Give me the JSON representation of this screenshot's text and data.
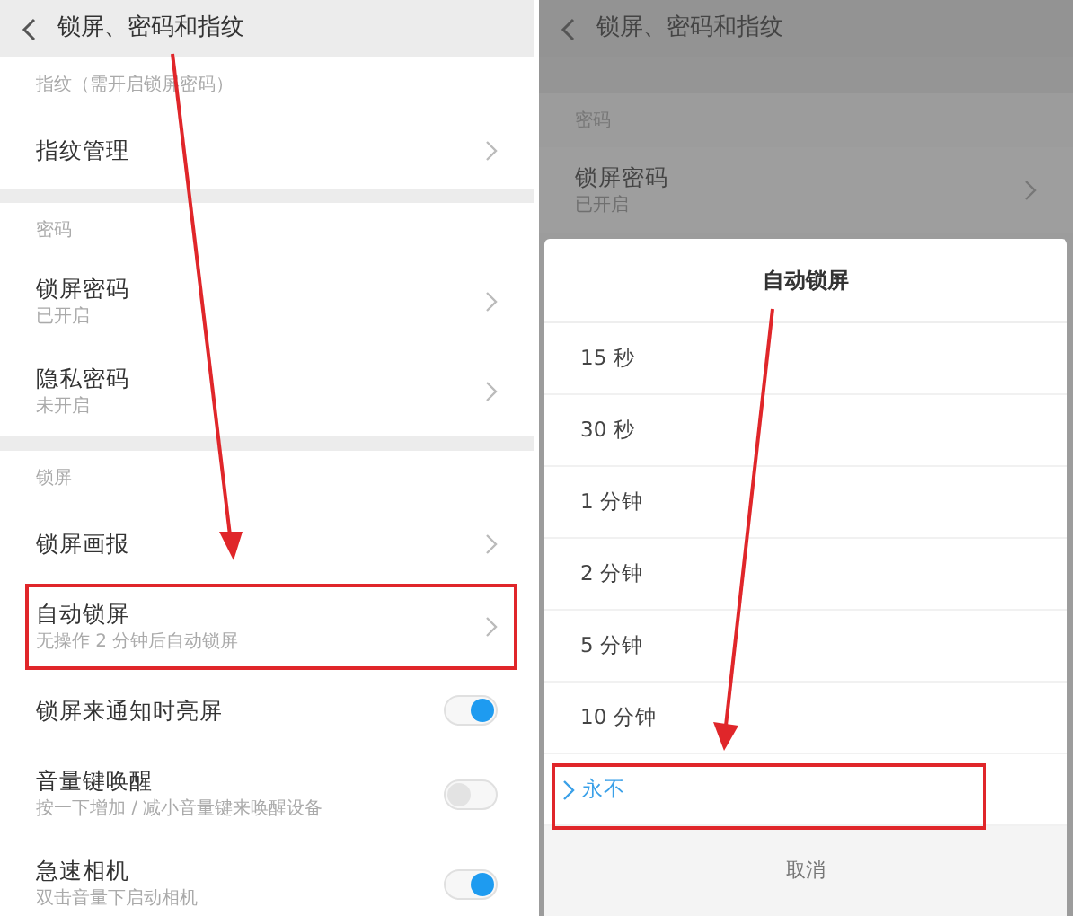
{
  "left_screen": {
    "title": "锁屏、密码和指纹",
    "sections": [
      {
        "label": "指纹（需开启锁屏密码）",
        "rows": [
          {
            "kind": "link",
            "title": "指纹管理",
            "highlighted": false
          }
        ]
      },
      {
        "label": "密码",
        "rows": [
          {
            "kind": "link",
            "title": "锁屏密码",
            "subtitle": "已开启",
            "highlighted": false
          },
          {
            "kind": "link",
            "title": "隐私密码",
            "subtitle": "未开启",
            "highlighted": false
          }
        ]
      },
      {
        "label": "锁屏",
        "rows": [
          {
            "kind": "link",
            "title": "锁屏画报",
            "highlighted": false
          },
          {
            "kind": "link",
            "title": "自动锁屏",
            "subtitle": "无操作 2 分钟后自动锁屏",
            "highlighted": true
          },
          {
            "kind": "toggle",
            "title": "锁屏来通知时亮屏",
            "on": true,
            "highlighted": false
          },
          {
            "kind": "toggle",
            "title": "音量键唤醒",
            "subtitle": "按一下增加 / 减小音量键来唤醒设备",
            "on": false,
            "highlighted": false
          },
          {
            "kind": "toggle",
            "title": "急速相机",
            "subtitle": "双击音量下启动相机",
            "on": true,
            "highlighted": false
          }
        ]
      }
    ]
  },
  "right_screen": {
    "title": "锁屏、密码和指纹",
    "section_label": "密码",
    "row": {
      "title": "锁屏密码",
      "subtitle": "已开启"
    },
    "dialog": {
      "title": "自动锁屏",
      "options": [
        {
          "label": "15 秒",
          "selected": false,
          "highlighted": false
        },
        {
          "label": "30 秒",
          "selected": false,
          "highlighted": false
        },
        {
          "label": "1 分钟",
          "selected": false,
          "highlighted": false
        },
        {
          "label": "2 分钟",
          "selected": false,
          "highlighted": false
        },
        {
          "label": "5 分钟",
          "selected": false,
          "highlighted": false
        },
        {
          "label": "10 分钟",
          "selected": false,
          "highlighted": false
        },
        {
          "label": "永不",
          "selected": true,
          "highlighted": true
        }
      ],
      "cancel": "取消"
    }
  }
}
